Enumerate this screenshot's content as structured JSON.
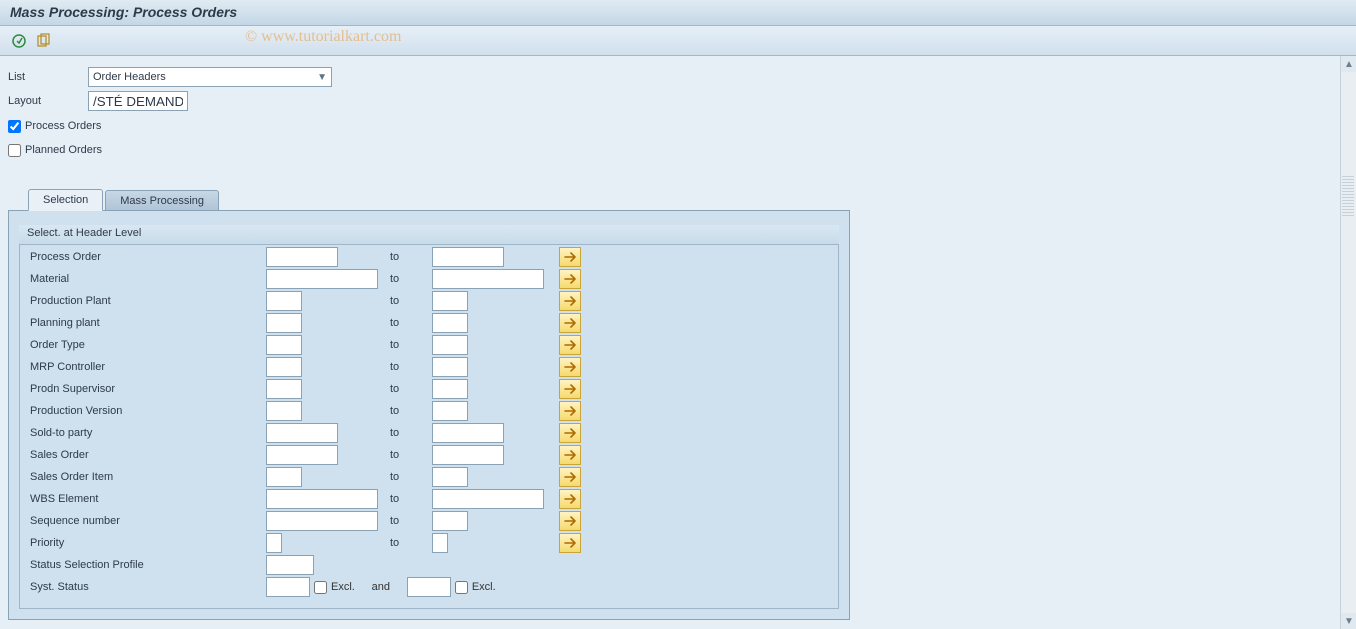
{
  "title": "Mass Processing: Process Orders",
  "watermark": "© www.tutorialkart.com",
  "header_form": {
    "list_label": "List",
    "list_value": "Order Headers",
    "layout_label": "Layout",
    "layout_value": "/STÉ DEMANDE",
    "process_orders_label": "Process Orders",
    "process_orders_checked": true,
    "planned_orders_label": "Planned Orders",
    "planned_orders_checked": false
  },
  "tabs": {
    "selection": "Selection",
    "mass_processing": "Mass Processing",
    "active": "selection"
  },
  "groupbox_title": "Select. at Header Level",
  "to_label": "to",
  "and_label": "and",
  "excl_label": "Excl.",
  "rows": [
    {
      "label": "Process Order",
      "from_w": "wmed",
      "to_w": "wmed",
      "more": true
    },
    {
      "label": "Material",
      "from_w": "wlong",
      "to_w": "wlong",
      "more": true
    },
    {
      "label": "Production Plant",
      "from_w": "wshort",
      "to_w": "wshort",
      "more": true
    },
    {
      "label": "Planning plant",
      "from_w": "wshort",
      "to_w": "wshort",
      "more": true
    },
    {
      "label": "Order Type",
      "from_w": "wshort",
      "to_w": "wshort",
      "more": true
    },
    {
      "label": "MRP Controller",
      "from_w": "wshort",
      "to_w": "wshort",
      "more": true
    },
    {
      "label": "Prodn Supervisor",
      "from_w": "wshort",
      "to_w": "wshort",
      "more": true
    },
    {
      "label": "Production Version",
      "from_w": "wshort",
      "to_w": "wshort",
      "more": true
    },
    {
      "label": "Sold-to party",
      "from_w": "wmed",
      "to_w": "wmed",
      "more": true
    },
    {
      "label": "Sales Order",
      "from_w": "wmed",
      "to_w": "wmed",
      "more": true
    },
    {
      "label": "Sales Order Item",
      "from_w": "wshort",
      "to_w": "wshort",
      "more": true
    },
    {
      "label": "WBS Element",
      "from_w": "wlong",
      "to_w": "wlong",
      "more": true
    },
    {
      "label": "Sequence number",
      "from_w": "wlong",
      "to_w": "wshort",
      "more": true
    },
    {
      "label": "Priority",
      "from_w": "wshort",
      "to_w": "wshort",
      "more": true,
      "tiny": true
    }
  ],
  "status_profile_label": "Status Selection Profile",
  "syst_status_label": "Syst. Status"
}
